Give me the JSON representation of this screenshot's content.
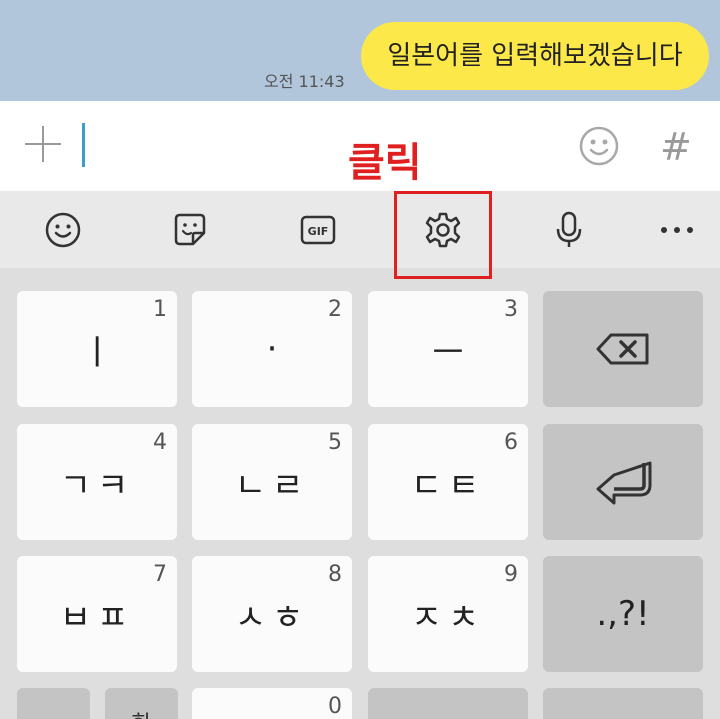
{
  "chat": {
    "message": "일본어를 입력해보겠습니다",
    "time": "오전 11:43"
  },
  "input": {
    "annotation": "클릭",
    "hash": "#"
  },
  "toolbar": {
    "items": [
      "emoji-icon",
      "sticker-icon",
      "gif-icon",
      "gear-icon",
      "microphone-icon",
      "more-icon"
    ],
    "gif_label": "GIF",
    "more_label": "•••"
  },
  "keyboard": {
    "row1": [
      {
        "label": "ㅣ",
        "num": "1"
      },
      {
        "label": "·",
        "num": "2"
      },
      {
        "label": "ㅡ",
        "num": "3"
      }
    ],
    "row2": [
      {
        "label": "ㄱㅋ",
        "num": "4"
      },
      {
        "label": "ㄴㄹ",
        "num": "5"
      },
      {
        "label": "ㄷㅌ",
        "num": "6"
      }
    ],
    "row3": [
      {
        "label": "ㅂㅍ",
        "num": "7"
      },
      {
        "label": "ㅅㅎ",
        "num": "8"
      },
      {
        "label": "ㅈㅊ",
        "num": "9"
      }
    ],
    "punct": ".,?!",
    "row4_num": "0",
    "row4_partial": "한"
  }
}
